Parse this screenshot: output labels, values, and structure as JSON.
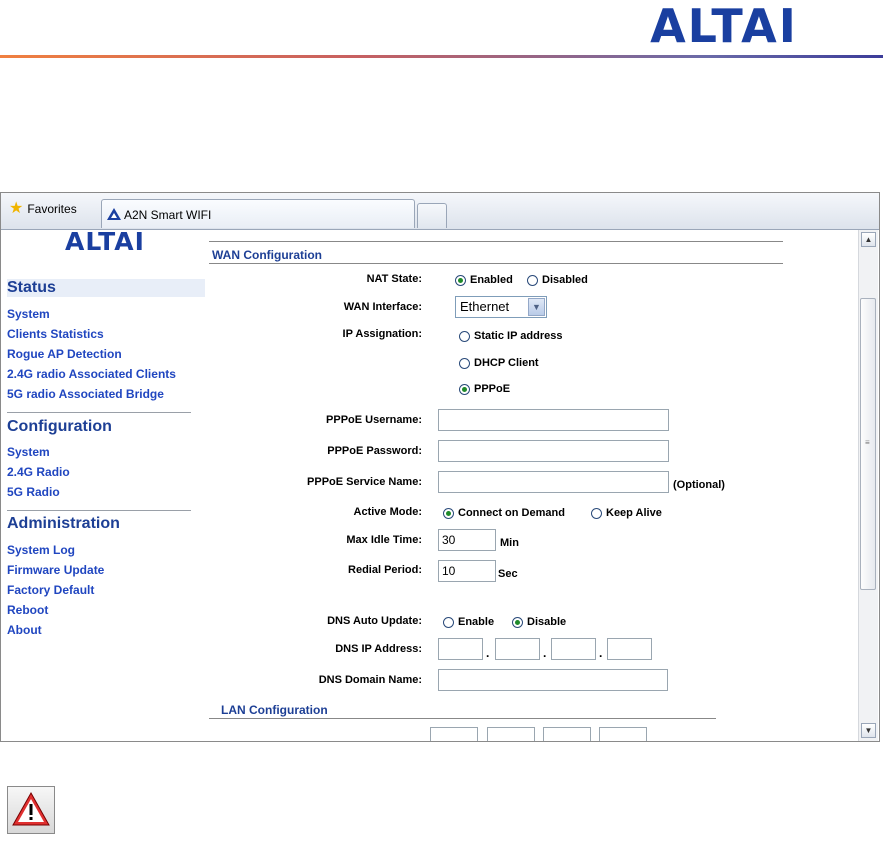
{
  "doc": {
    "logo_text": "ALTAI",
    "brand_color": "#1a3fa0",
    "accent_color": "#f08040"
  },
  "browser": {
    "favorites_label": "Favorites",
    "tab_title": "A2N Smart WIFI",
    "icons": {
      "favorites": "star-icon",
      "tab": "altai-tab-icon",
      "new_tab": "new-tab-button"
    }
  },
  "sidebar": {
    "logo_text": "ALTAI",
    "status": {
      "heading": "Status",
      "items": [
        "System",
        "Clients Statistics",
        "Rogue AP Detection",
        "2.4G radio Associated Clients",
        "5G radio Associated Bridge"
      ]
    },
    "configuration": {
      "heading": "Configuration",
      "items": [
        "System",
        "2.4G Radio",
        "5G Radio"
      ]
    },
    "administration": {
      "heading": "Administration",
      "items": [
        "System Log",
        "Firmware Update",
        "Factory Default",
        "Reboot",
        "About"
      ]
    }
  },
  "wan": {
    "title": "WAN Configuration",
    "nat_state": {
      "label": "NAT State:",
      "options": [
        "Enabled",
        "Disabled"
      ],
      "selected": "Enabled"
    },
    "wan_interface": {
      "label": "WAN Interface:",
      "value": "Ethernet"
    },
    "ip_assignation": {
      "label": "IP Assignation:",
      "options": [
        "Static IP address",
        "DHCP Client",
        "PPPoE"
      ],
      "selected": "PPPoE"
    },
    "pppoe_username": {
      "label": "PPPoE Username:",
      "value": ""
    },
    "pppoe_password": {
      "label": "PPPoE Password:",
      "value": ""
    },
    "pppoe_service_name": {
      "label": "PPPoE Service Name:",
      "value": "",
      "hint": "(Optional)"
    },
    "active_mode": {
      "label": "Active Mode:",
      "options": [
        "Connect on Demand",
        "Keep Alive"
      ],
      "selected": "Connect on Demand"
    },
    "max_idle_time": {
      "label": "Max Idle Time:",
      "value": "30",
      "unit": "Min"
    },
    "redial_period": {
      "label": "Redial Period:",
      "value": "10",
      "unit": "Sec"
    },
    "dns_auto_update": {
      "label": "DNS Auto Update:",
      "options": [
        "Enable",
        "Disable"
      ],
      "selected": "Disable"
    },
    "dns_ip_address": {
      "label": "DNS IP Address:",
      "octets": [
        "",
        "",
        "",
        ""
      ]
    },
    "dns_domain_name": {
      "label": "DNS Domain Name:",
      "value": ""
    }
  },
  "lan": {
    "title": "LAN Configuration"
  },
  "warning_icon": "warning-icon"
}
